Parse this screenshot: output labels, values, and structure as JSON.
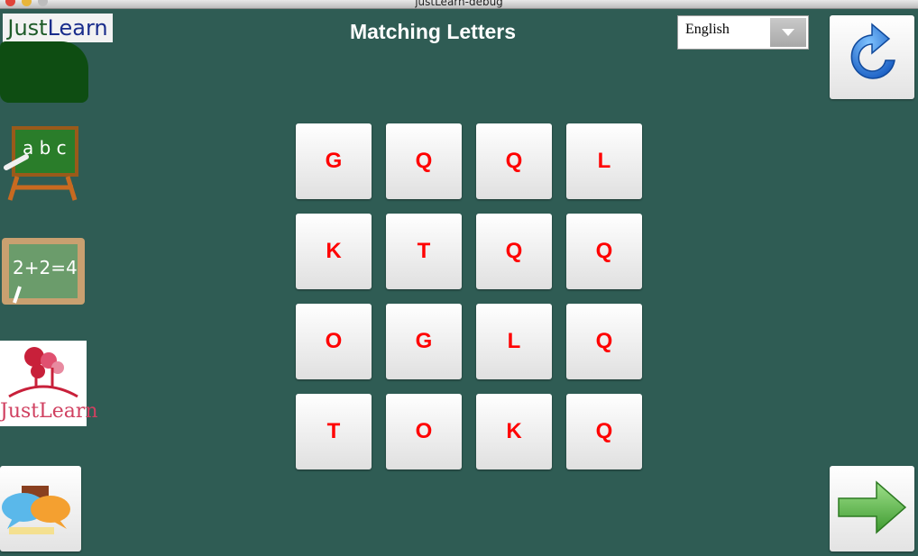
{
  "window": {
    "title": "justLearn-debug"
  },
  "brand": {
    "part1": "Just",
    "part2": "Learn"
  },
  "page_title": "Matching Letters",
  "language": {
    "selected": "English"
  },
  "logo_text": "JustLearn",
  "abc_board_text": "a b c",
  "math_board_text": "2+2=4",
  "tiles": [
    "G",
    "Q",
    "Q",
    "L",
    "K",
    "T",
    "Q",
    "Q",
    "O",
    "G",
    "L",
    "Q",
    "T",
    "O",
    "K",
    "Q"
  ],
  "colors": {
    "background": "#2f5c54",
    "tile_letter": "#ff0000",
    "brand_dark_green": "#0e4d12"
  },
  "icons": {
    "refresh": "refresh-arrow-icon",
    "next": "green-right-arrow-icon",
    "chat": "speech-bubbles-icon",
    "abc": "chalkboard-abc-icon",
    "math": "chalkboard-math-icon"
  }
}
